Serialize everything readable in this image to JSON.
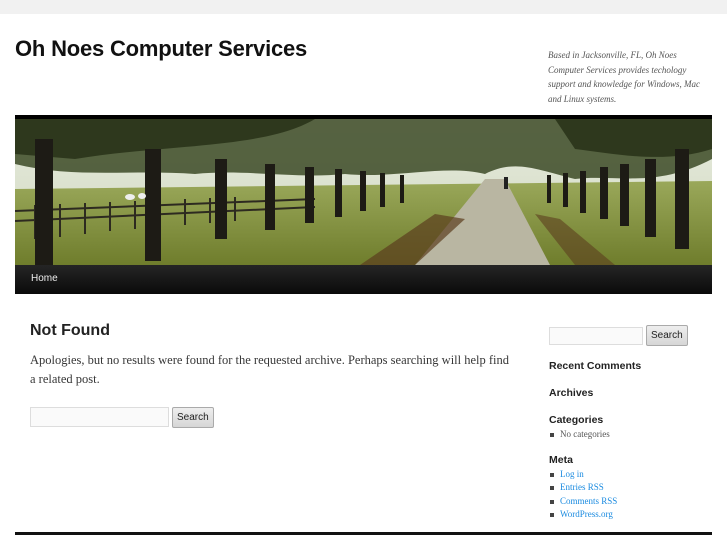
{
  "header": {
    "site_title": "Oh Noes Computer Services",
    "site_description": "Based in Jacksonville, FL, Oh Noes Computer Services provides techology support and knowledge for Windows, Mac and Linux systems."
  },
  "menu": {
    "items": [
      {
        "label": "Home"
      }
    ]
  },
  "main": {
    "title": "Not Found",
    "message": "Apologies, but no results were found for the requested archive. Perhaps searching will help find a related post.",
    "search": {
      "value": "",
      "button_label": "Search"
    }
  },
  "sidebar": {
    "search": {
      "value": "",
      "button_label": "Search"
    },
    "recent_comments_title": "Recent Comments",
    "archives_title": "Archives",
    "categories_title": "Categories",
    "categories_items": [
      {
        "label": "No categories"
      }
    ],
    "meta_title": "Meta",
    "meta_items": [
      {
        "label": "Log in"
      },
      {
        "label": "Entries RSS"
      },
      {
        "label": "Comments RSS"
      },
      {
        "label": "WordPress.org"
      }
    ]
  },
  "colors": {
    "menu_bar": "#111111",
    "link": "#1b8be0",
    "background": "#f1f1f1"
  }
}
